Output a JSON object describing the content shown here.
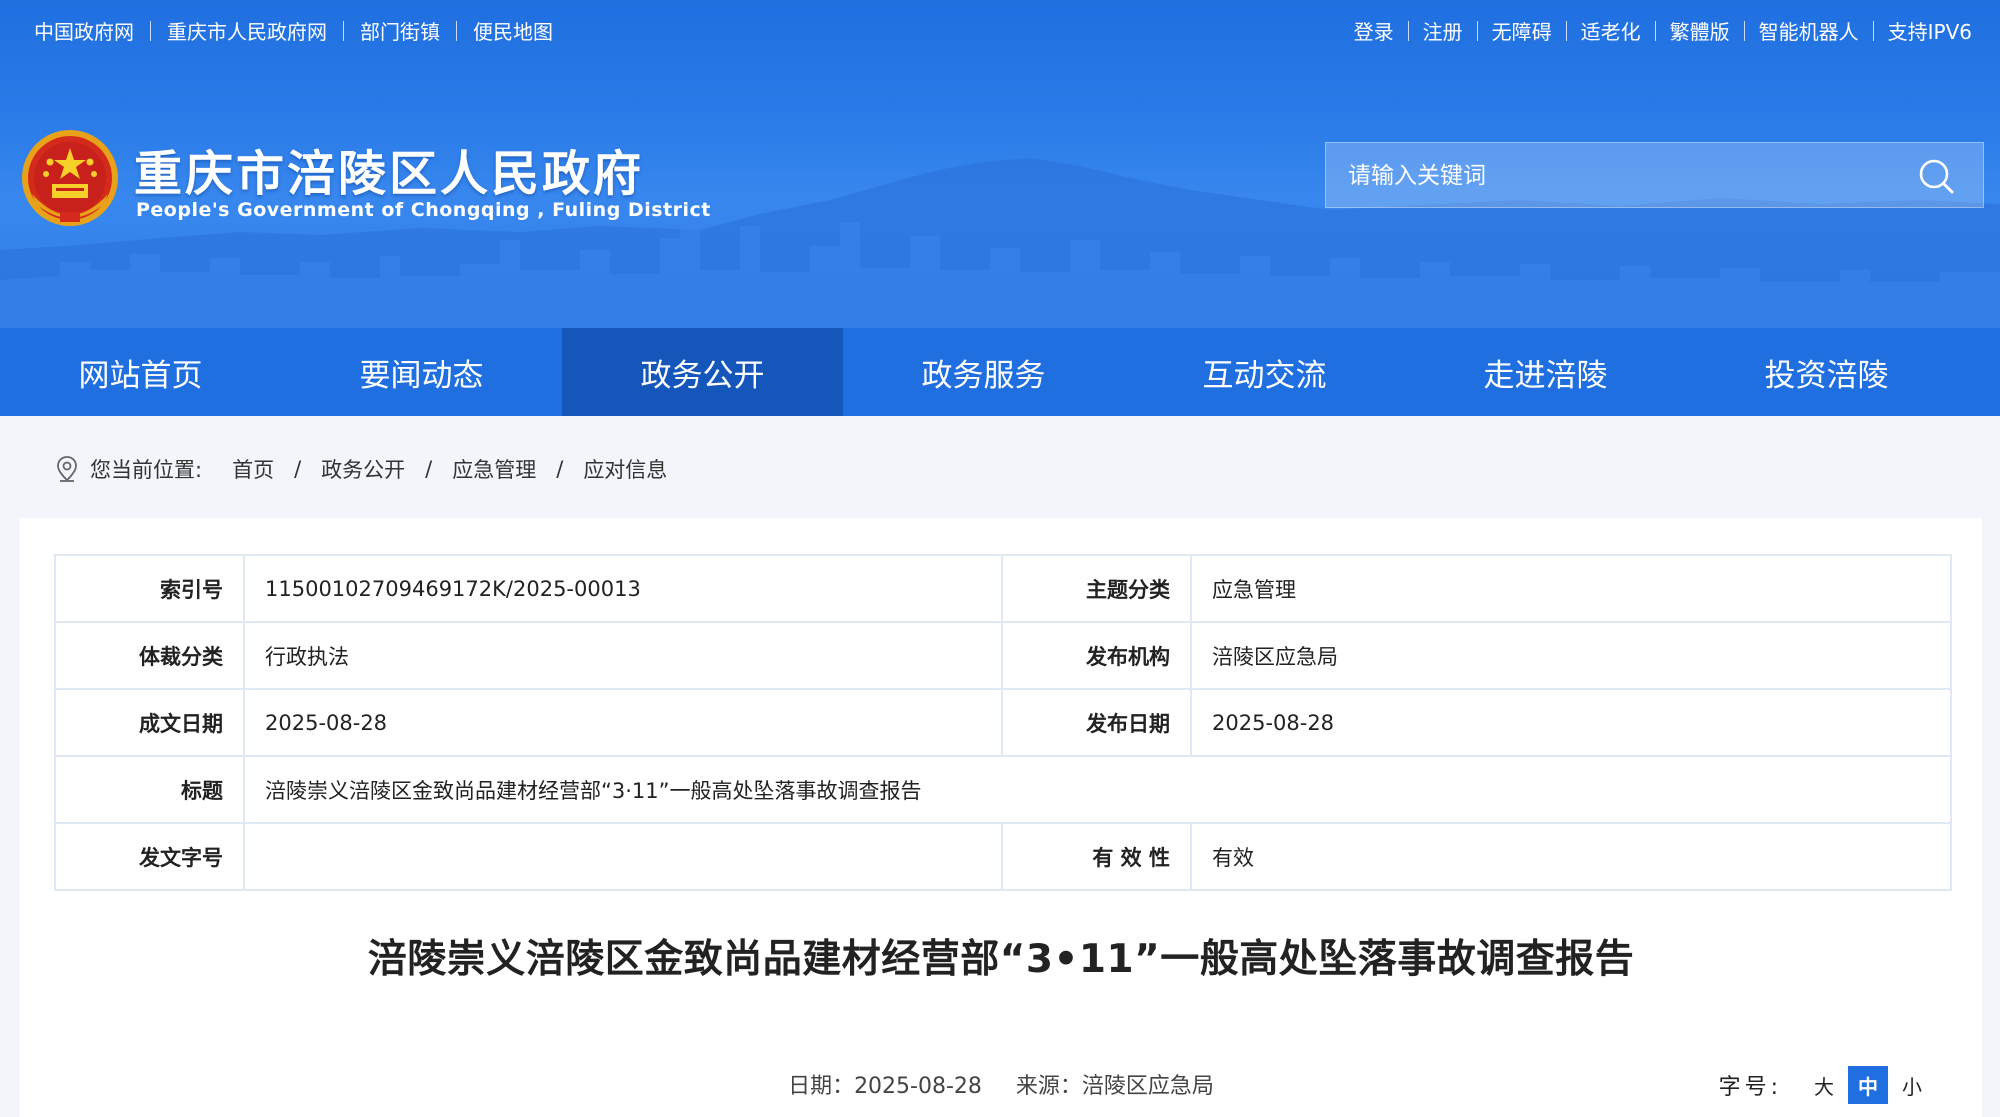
{
  "topbar": {
    "left_links": [
      "中国政府网",
      "重庆市人民政府网",
      "部门街镇",
      "便民地图"
    ],
    "right_links": [
      "登录",
      "注册",
      "无障碍",
      "适老化",
      "繁體版",
      "智能机器人",
      "支持IPV6"
    ]
  },
  "header": {
    "title": "重庆市涪陵区人民政府",
    "subtitle": "People's Government of Chongqing , Fuling District",
    "emblem_icon": "national-emblem-icon"
  },
  "search": {
    "placeholder": "请输入关键词",
    "icon": "search-icon"
  },
  "nav": {
    "items": [
      "网站首页",
      "要闻动态",
      "政务公开",
      "政务服务",
      "互动交流",
      "走进涪陵",
      "投资涪陵"
    ],
    "active": "政务公开"
  },
  "breadcrumb": {
    "icon": "location-pin-icon",
    "prefix": "您当前位置:",
    "items": [
      "首页",
      "政务公开",
      "应急管理",
      "应对信息"
    ],
    "separator": "/"
  },
  "meta": {
    "index_label": "索引号",
    "index_value": "11500102709469172K/2025-00013",
    "topic_label": "主题分类",
    "topic_value": "应急管理",
    "genre_label": "体裁分类",
    "genre_value": "行政执法",
    "publisher_label": "发布机构",
    "publisher_value": "涪陵区应急局",
    "written_date_label": "成文日期",
    "written_date_value": "2025-08-28",
    "publish_date_label": "发布日期",
    "publish_date_value": "2025-08-28",
    "title_label": "标题",
    "title_value": "涪陵崇义涪陵区金致尚品建材经营部“3·11”一般高处坠落事故调查报告",
    "doc_number_label": "发文字号",
    "doc_number_value": "",
    "validity_label": "有 效 性",
    "validity_value": "有效"
  },
  "article": {
    "title": "涪陵崇义涪陵区金致尚品建材经营部“3•11”一般高处坠落事故调查报告",
    "date_text": "日期：2025-08-28",
    "source_text": "来源：涪陵区应急局"
  },
  "font_size": {
    "label": "字号:",
    "large": "大",
    "medium": "中",
    "small": "小",
    "active": "中"
  },
  "colors": {
    "header_blue": "#1f6fe0",
    "nav_active": "#1556bb",
    "table_border": "#dfe9f4",
    "page_bg": "#f2f5f9"
  }
}
